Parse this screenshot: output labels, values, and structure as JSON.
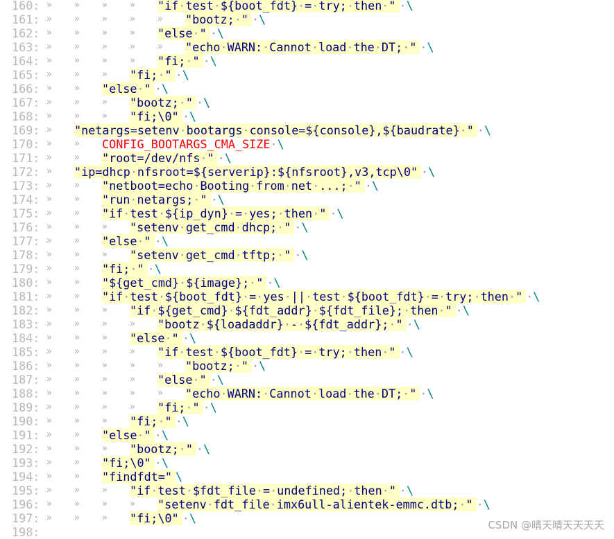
{
  "editor": {
    "colors": {
      "text": "#00007f",
      "string_bg": "#ffffc6",
      "macro": "#ff0000",
      "backslash": "#008080",
      "whitespace": "#9a9a9a",
      "line_number": "#b8b8b8"
    },
    "tab_marker": "»",
    "space_marker": "·",
    "lines": [
      {
        "n": "160:",
        "tabs": 4,
        "str": "\"if test ${boot_fdt} = try; then \"",
        "tail": " \\"
      },
      {
        "n": "161:",
        "tabs": 5,
        "str": "\"bootz; \"",
        "tail": " \\"
      },
      {
        "n": "162:",
        "tabs": 4,
        "str": "\"else \"",
        "tail": " \\"
      },
      {
        "n": "163:",
        "tabs": 5,
        "str": "\"echo WARN: Cannot load the DT; \"",
        "tail": " \\"
      },
      {
        "n": "164:",
        "tabs": 4,
        "str": "\"fi; \"",
        "tail": " \\"
      },
      {
        "n": "165:",
        "tabs": 3,
        "str": "\"fi; \"",
        "tail": " \\"
      },
      {
        "n": "166:",
        "tabs": 2,
        "str": "\"else \"",
        "tail": " \\"
      },
      {
        "n": "167:",
        "tabs": 3,
        "str": "\"bootz; \"",
        "tail": " \\"
      },
      {
        "n": "168:",
        "tabs": 3,
        "str": "\"fi;\\0\"",
        "tail": " \\"
      },
      {
        "n": "169:",
        "tabs": 1,
        "str": "\"netargs=setenv bootargs console=${console},${baudrate} \"",
        "tail": " \\"
      },
      {
        "n": "170:",
        "tabs": 2,
        "macro": "CONFIG_BOOTARGS_CMA_SIZE",
        "tail": " \\"
      },
      {
        "n": "171:",
        "tabs": 2,
        "str": "\"root=/dev/nfs \"",
        "tail": " \\"
      },
      {
        "n": "172:",
        "tabs": 1,
        "str": "\"ip=dhcp nfsroot=${serverip}:${nfsroot},v3,tcp\\0\"",
        "tail": " \\"
      },
      {
        "n": "173:",
        "tabs": 2,
        "str": "\"netboot=echo Booting from net ...; \"",
        "tail": " \\"
      },
      {
        "n": "174:",
        "tabs": 2,
        "str": "\"run netargs; \"",
        "tail": " \\"
      },
      {
        "n": "175:",
        "tabs": 2,
        "str": "\"if test ${ip_dyn} = yes; then \"",
        "tail": " \\"
      },
      {
        "n": "176:",
        "tabs": 3,
        "str": "\"setenv get_cmd dhcp; \"",
        "tail": " \\"
      },
      {
        "n": "177:",
        "tabs": 2,
        "str": "\"else \"",
        "tail": " \\"
      },
      {
        "n": "178:",
        "tabs": 3,
        "str": "\"setenv get_cmd tftp; \"",
        "tail": " \\"
      },
      {
        "n": "179:",
        "tabs": 2,
        "str": "\"fi; \"",
        "tail": " \\"
      },
      {
        "n": "180:",
        "tabs": 2,
        "str": "\"${get_cmd} ${image}; \"",
        "tail": " \\"
      },
      {
        "n": "181:",
        "tabs": 2,
        "str": "\"if test ${boot_fdt} = yes || test ${boot_fdt} = try; then \"",
        "tail": " \\"
      },
      {
        "n": "182:",
        "tabs": 3,
        "str": "\"if ${get_cmd} ${fdt_addr} ${fdt_file}; then \"",
        "tail": " \\"
      },
      {
        "n": "183:",
        "tabs": 4,
        "str": "\"bootz ${loadaddr} - ${fdt_addr}; \"",
        "tail": " \\"
      },
      {
        "n": "184:",
        "tabs": 3,
        "str": "\"else \"",
        "tail": " \\"
      },
      {
        "n": "185:",
        "tabs": 4,
        "str": "\"if test ${boot_fdt} = try; then \"",
        "tail": " \\"
      },
      {
        "n": "186:",
        "tabs": 5,
        "str": "\"bootz; \"",
        "tail": " \\"
      },
      {
        "n": "187:",
        "tabs": 4,
        "str": "\"else \"",
        "tail": " \\"
      },
      {
        "n": "188:",
        "tabs": 5,
        "str": "\"echo WARN: Cannot load the DT; \"",
        "tail": " \\"
      },
      {
        "n": "189:",
        "tabs": 4,
        "str": "\"fi; \"",
        "tail": " \\"
      },
      {
        "n": "190:",
        "tabs": 3,
        "str": "\"fi; \"",
        "tail": " \\"
      },
      {
        "n": "191:",
        "tabs": 2,
        "str": "\"else \"",
        "tail": " \\"
      },
      {
        "n": "192:",
        "tabs": 3,
        "str": "\"bootz; \"",
        "tail": " \\"
      },
      {
        "n": "193:",
        "tabs": 2,
        "str": "\"fi;\\0\"",
        "tail": " \\"
      },
      {
        "n": "194:",
        "tabs": 2,
        "str": "\"findfdt=\"",
        "tail": "\\"
      },
      {
        "n": "195:",
        "tabs": 3,
        "str": "\"if test $fdt_file = undefined; then \"",
        "tail": " \\"
      },
      {
        "n": "196:",
        "tabs": 4,
        "str": "\"setenv fdt_file imx6ull-alientek-emmc.dtb; \"",
        "tail": " \\"
      },
      {
        "n": "197:",
        "tabs": 3,
        "str": "\"fi;\\0\"",
        "tail": " \\"
      },
      {
        "n": "198:",
        "tabs": 0
      }
    ]
  },
  "watermark": "CSDN @晴天晴天天天天"
}
